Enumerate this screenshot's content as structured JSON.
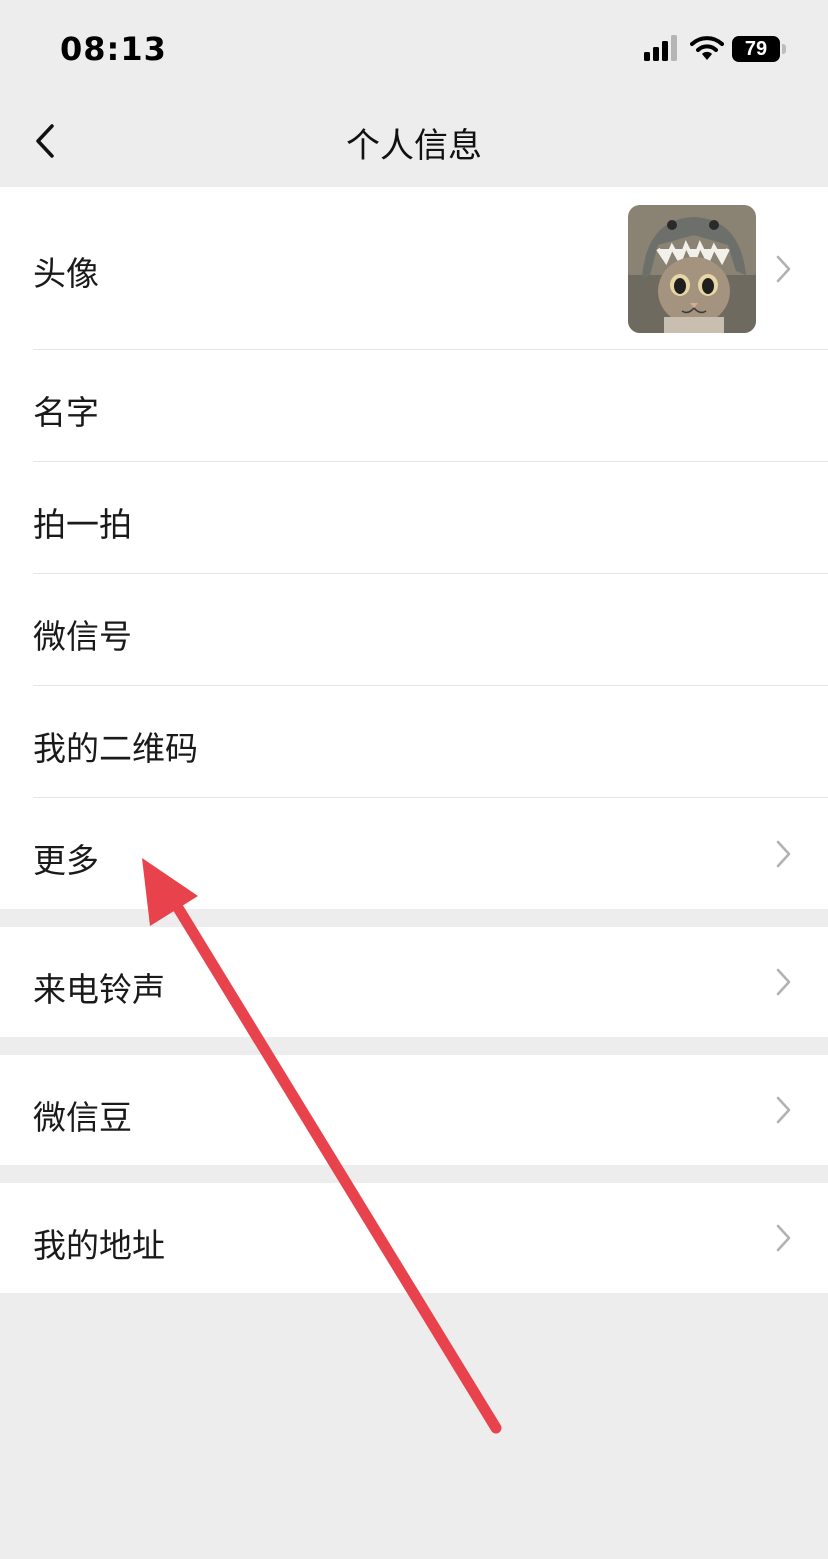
{
  "status_bar": {
    "time": "08:13",
    "battery": "79"
  },
  "nav": {
    "title": "个人信息"
  },
  "groups": [
    {
      "rows": [
        {
          "label": "头像"
        },
        {
          "label": "名字"
        },
        {
          "label": "拍一拍"
        },
        {
          "label": "微信号"
        },
        {
          "label": "我的二维码"
        },
        {
          "label": "更多"
        }
      ]
    },
    {
      "rows": [
        {
          "label": "来电铃声"
        }
      ]
    },
    {
      "rows": [
        {
          "label": "微信豆"
        }
      ]
    },
    {
      "rows": [
        {
          "label": "我的地址"
        }
      ]
    }
  ],
  "colors": {
    "background": "#ededed",
    "annotation_arrow": "#e8434c"
  },
  "icons": [
    "back-chevron",
    "chevron-right",
    "signal",
    "wifi",
    "battery"
  ]
}
